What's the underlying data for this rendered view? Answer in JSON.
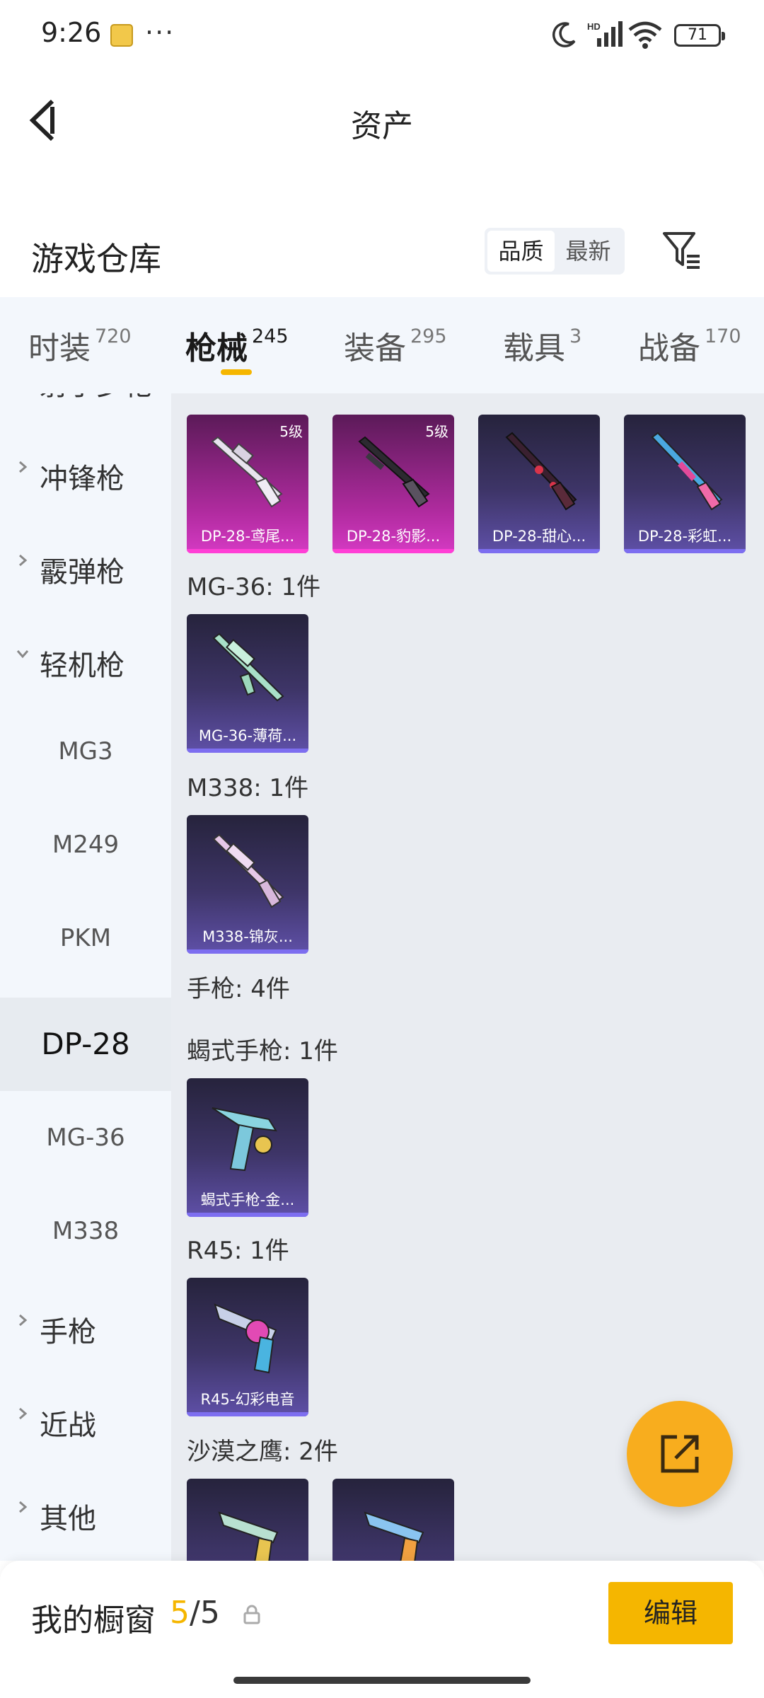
{
  "status_bar": {
    "time": "9:26",
    "dots": "···",
    "battery": "71",
    "hd": "HD"
  },
  "header": {
    "title": "资产"
  },
  "warehouse": {
    "title": "游戏仓库",
    "sort_options": [
      {
        "label": "品质",
        "active": true
      },
      {
        "label": "最新",
        "active": false
      }
    ]
  },
  "tabs": [
    {
      "name": "时装",
      "count": "720"
    },
    {
      "name": "枪械",
      "count": "245",
      "active": true
    },
    {
      "name": "装备",
      "count": "295"
    },
    {
      "name": "载具",
      "count": "3"
    },
    {
      "name": "战备",
      "count": "170"
    }
  ],
  "sidebar": {
    "partial_top": "射手步枪",
    "categories": [
      {
        "label": "冲锋枪",
        "expanded": false
      },
      {
        "label": "霰弹枪",
        "expanded": false
      },
      {
        "label": "轻机枪",
        "expanded": true
      }
    ],
    "subitems": [
      {
        "label": "MG3"
      },
      {
        "label": "M249"
      },
      {
        "label": "PKM"
      },
      {
        "label": "DP-28",
        "active": true
      },
      {
        "label": "MG-36"
      },
      {
        "label": "M338"
      }
    ],
    "bottom_categories": [
      {
        "label": "手枪"
      },
      {
        "label": "近战"
      },
      {
        "label": "其他"
      }
    ]
  },
  "content": {
    "dp28_cards": [
      {
        "name": "DP-28-鸢尾...",
        "level": "5级",
        "tier": "pink"
      },
      {
        "name": "DP-28-豹影...",
        "level": "5级",
        "tier": "pink"
      },
      {
        "name": "DP-28-甜心...",
        "tier": "purple"
      },
      {
        "name": "DP-28-彩虹...",
        "tier": "purple"
      }
    ],
    "mg36": {
      "title": "MG-36: 1件",
      "cards": [
        {
          "name": "MG-36-薄荷..."
        }
      ]
    },
    "m338": {
      "title": "M338: 1件",
      "cards": [
        {
          "name": "M338-锦灰..."
        }
      ]
    },
    "pistol_title": "手枪: 4件",
    "scorpion": {
      "title": "蝎式手枪: 1件",
      "cards": [
        {
          "name": "蝎式手枪-金..."
        }
      ]
    },
    "r45": {
      "title": "R45: 1件",
      "cards": [
        {
          "name": "R45-幻彩电音"
        }
      ]
    },
    "deagle": {
      "title": "沙漠之鹰: 2件"
    }
  },
  "bottom_bar": {
    "title": "我的橱窗",
    "current": "5",
    "separator": "/",
    "total": "5",
    "edit_label": "编辑"
  },
  "colors": {
    "accent": "#f5b600",
    "fab": "#f8ad1e",
    "tier_pink": "#d53ac3",
    "tier_purple": "#5f50a8"
  },
  "icons": [
    "moon-icon",
    "signal-icon",
    "wifi-icon",
    "battery-icon",
    "back-icon",
    "filter-icon",
    "chevron-right-icon",
    "chevron-down-icon",
    "share-icon",
    "lock-icon"
  ]
}
